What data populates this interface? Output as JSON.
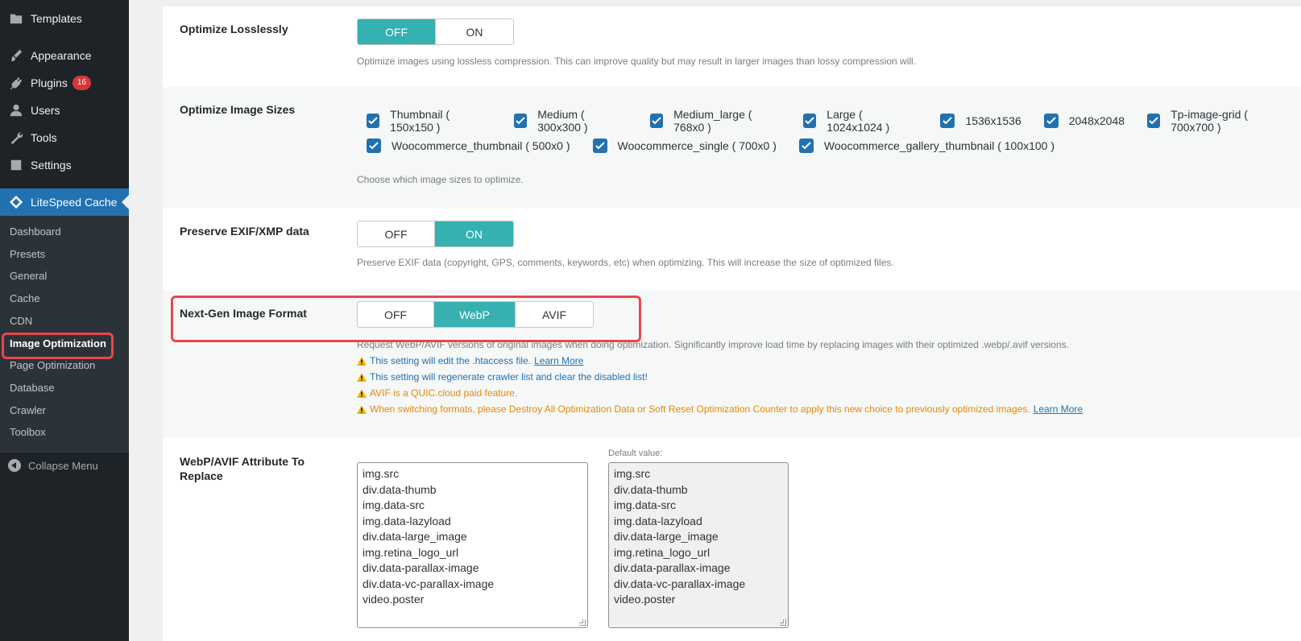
{
  "sidebar": {
    "items": [
      {
        "label": "Templates",
        "icon": "folder-icon"
      },
      {
        "label": "Appearance",
        "icon": "paintbrush-icon"
      },
      {
        "label": "Plugins",
        "icon": "plug-icon",
        "badge": "16"
      },
      {
        "label": "Users",
        "icon": "user-icon"
      },
      {
        "label": "Tools",
        "icon": "wrench-icon"
      },
      {
        "label": "Settings",
        "icon": "settings-icon"
      },
      {
        "label": "LiteSpeed Cache",
        "icon": "litespeed-icon"
      }
    ],
    "submenu": [
      "Dashboard",
      "Presets",
      "General",
      "Cache",
      "CDN",
      "Image Optimization",
      "Page Optimization",
      "Database",
      "Crawler",
      "Toolbox"
    ],
    "collapse_label": "Collapse Menu"
  },
  "settings": {
    "lossless": {
      "label": "Optimize Losslessly",
      "options": [
        "OFF",
        "ON"
      ],
      "selected": "OFF",
      "description": "Optimize images using lossless compression. This can improve quality but may result in larger images than lossy compression will."
    },
    "image_sizes": {
      "label": "Optimize Image Sizes",
      "row1": [
        "Thumbnail ( 150x150 )",
        "Medium ( 300x300 )",
        "Medium_large ( 768x0 )",
        "Large ( 1024x1024 )",
        "1536x1536",
        "2048x2048",
        "Tp-image-grid ( 700x700 )"
      ],
      "row2": [
        "Woocommerce_thumbnail ( 500x0 )",
        "Woocommerce_single ( 700x0 )",
        "Woocommerce_gallery_thumbnail ( 100x100 )"
      ],
      "description": "Choose which image sizes to optimize."
    },
    "exif": {
      "label": "Preserve EXIF/XMP data",
      "options": [
        "OFF",
        "ON"
      ],
      "selected": "ON",
      "description": "Preserve EXIF data (copyright, GPS, comments, keywords, etc) when optimizing. This will increase the size of optimized files."
    },
    "nextgen": {
      "label": "Next-Gen Image Format",
      "options": [
        "OFF",
        "WebP",
        "AVIF"
      ],
      "selected": "WebP",
      "description": "Request WebP/AVIF versions of original images when doing optimization. Significantly improve load time by replacing images with their optimized .webp/.avif versions.",
      "notes": [
        {
          "text": "This setting will edit the .htaccess file.",
          "link": "Learn More",
          "color": "blue"
        },
        {
          "text": "This setting will regenerate crawler list and clear the disabled list!",
          "color": "blue"
        },
        {
          "text": "AVIF is a QUIC.cloud paid feature.",
          "color": "orange"
        },
        {
          "text": "When switching formats, please Destroy All Optimization Data or Soft Reset Optimization Counter to apply this new choice to previously optimized images.",
          "link": "Learn More",
          "color": "orange"
        }
      ]
    },
    "attr_replace": {
      "label": "WebP/AVIF Attribute To Replace",
      "values": [
        "img.src",
        "div.data-thumb",
        "img.data-src",
        "img.data-lazyload",
        "div.data-large_image",
        "img.retina_logo_url",
        "div.data-parallax-image",
        "div.data-vc-parallax-image",
        "video.poster"
      ],
      "default_label": "Default value:",
      "default_values": [
        "img.src",
        "div.data-thumb",
        "img.data-src",
        "img.data-lazyload",
        "div.data-large_image",
        "img.retina_logo_url",
        "div.data-parallax-image",
        "div.data-vc-parallax-image",
        "video.poster"
      ]
    }
  },
  "colors": {
    "toggle_on": "#36b0b0",
    "highlight": "#e8474c",
    "sidebar_bg": "#1d2327",
    "menu_active": "#2271b1"
  }
}
